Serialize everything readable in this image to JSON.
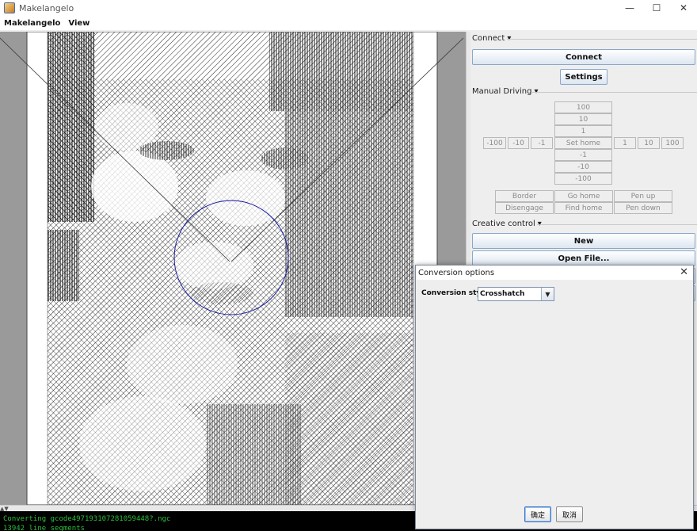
{
  "window": {
    "title": "Makelangelo",
    "controls": {
      "minimize": "—",
      "maximize": "☐",
      "close": "✕"
    }
  },
  "menu": {
    "items": [
      "Makelangelo",
      "View"
    ]
  },
  "panel": {
    "connect_section": {
      "label": "Connect",
      "connect_btn": "Connect",
      "settings_btn": "Settings"
    },
    "manual_section": {
      "label": "Manual Driving",
      "y_plus": [
        "100",
        "10",
        "1"
      ],
      "x_minus": [
        "-100",
        "-10",
        "-1"
      ],
      "set_home": "Set home",
      "x_plus": [
        "1",
        "10",
        "100"
      ],
      "y_minus": [
        "-1",
        "-10",
        "-100"
      ],
      "row1": [
        "Border",
        "Go home",
        "Pen up"
      ],
      "row2": [
        "Disengage",
        "Find home",
        "Pen down"
      ]
    },
    "creative_section": {
      "label": "Creative control",
      "new_btn": "New",
      "open_btn": "Open File..."
    }
  },
  "log": {
    "lines": [
      "Converting gcode497193107281059448?.ngc",
      "13942 line segments"
    ]
  },
  "dialog": {
    "title": "Conversion options",
    "style_label": "Conversion style",
    "style_value": "Crosshatch",
    "ok": "确定",
    "cancel": "取消"
  },
  "colors": {
    "accent": "#8aa7c8",
    "log_text": "#2bbf3a",
    "circle": "#1a1aa0"
  }
}
